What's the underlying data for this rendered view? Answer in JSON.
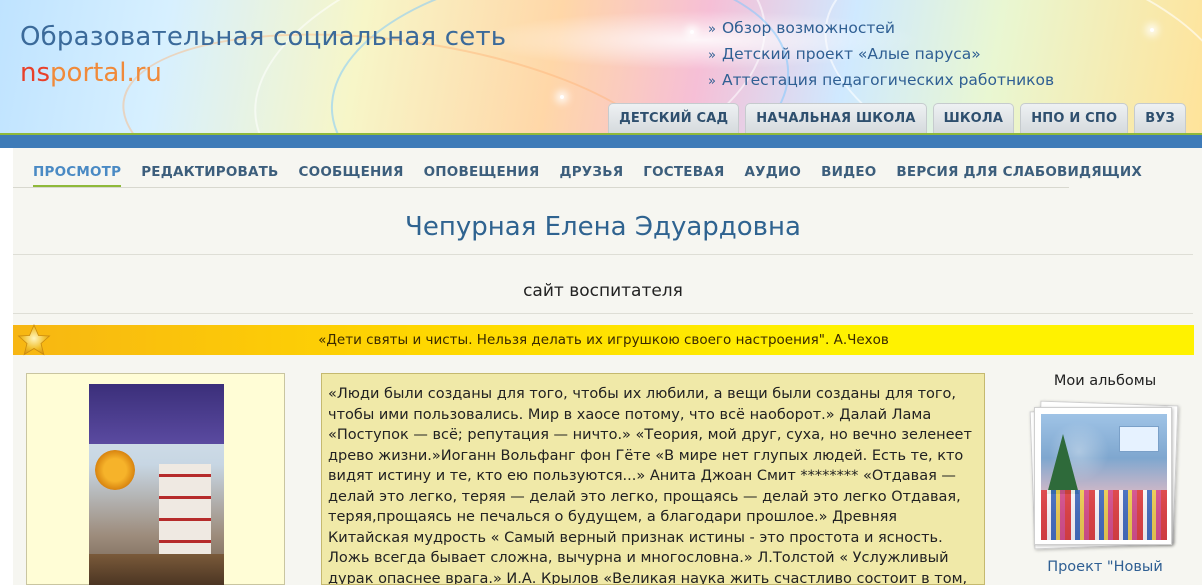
{
  "header": {
    "site_title": "Образовательная социальная сеть",
    "logo_ns": "ns",
    "logo_rest": "portal.ru",
    "top_links": [
      "Обзор возможностей",
      "Детский проект «Алые паруса»",
      "Аттестация педагогических работников"
    ],
    "bullet": "»",
    "tabs": [
      "ДЕТСКИЙ САД",
      "НАЧАЛЬНАЯ ШКОЛА",
      "ШКОЛА",
      "НПО И СПО",
      "ВУЗ"
    ]
  },
  "user_nav": [
    "ПРОСМОТР",
    "РЕДАКТИРОВАТЬ",
    "СООБЩЕНИЯ",
    "ОПОВЕЩЕНИЯ",
    "ДРУЗЬЯ",
    "ГОСТЕВАЯ",
    "АУДИО",
    "ВИДЕО",
    "ВЕРСИЯ ДЛЯ СЛАБОВИДЯЩИХ"
  ],
  "user_nav_active": 0,
  "profile": {
    "name": "Чепурная Елена Эдуардовна",
    "subtitle": "сайт воспитателя",
    "quote": "«Дети святы и чисты. Нельзя делать их игрушкою своего настроения\". А.Чехов",
    "about_text": "«Люди были созданы для того, чтобы их любили, а вещи были созданы для того, чтобы ими пользовались. Мир в хаосе потому, что всё наоборот.» Далай Лама «Поступок — всё; репутация — ничто.» «Теория, мой друг, суха, но вечно зеленеет древо жизни.»Иоганн Вольфанг фон Гёте «В мире нет глупых людей. Есть те, кто видят истину и те, кто ею пользуются...» Анита Джоан Смит ******** «Отдавая — делай это легко, теряя — делай это легко, прощаясь — делай это легко Отдавая, теряя,прощаясь не печалься о будущем, а благодари прошлое.» Древняя Китайская мудрость « Самый верный признак истины - это простота и ясность. Ложь всегда бывает сложна, вычурна и многословна.» Л.Толстой « Услужливый дурак опаснее врага.» И.А. Крылов «Великая наука жить счастливо состоит в том, чтобы жить"
  },
  "albums": {
    "title": "Мои альбомы",
    "first_album_label": "Проект \"Новый"
  },
  "colors": {
    "header_bar": "#3e7bb8",
    "accent_green": "#8fb93a",
    "link_blue": "#2f5f93",
    "quote_bar": "#fff200",
    "about_bg": "#f0e9a8"
  }
}
